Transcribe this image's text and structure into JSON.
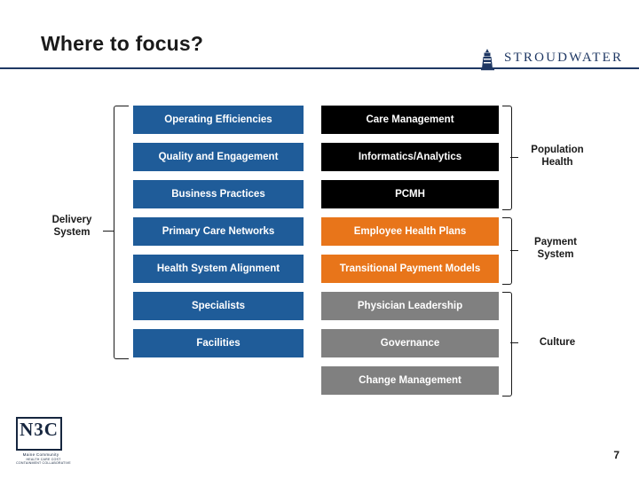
{
  "slide": {
    "title": "Where to focus?",
    "page_number": "7",
    "accent_rule_color": "#1f3864"
  },
  "brand_logo": {
    "name": "STROUDWATER",
    "icon": "lighthouse-icon",
    "color": "#1f3864"
  },
  "footer_logo": {
    "abbr": "N3C",
    "line1": "Maine Community",
    "line2": "HEALTH CARE COST CONTAINMENT COLLABORATIVE"
  },
  "side_labels": {
    "delivery_system": "Delivery\nSystem",
    "delivery_system_line1": "Delivery",
    "delivery_system_line2": "System",
    "population_health_line1": "Population",
    "population_health_line2": "Health",
    "payment_system_line1": "Payment",
    "payment_system_line2": "System",
    "culture": "Culture"
  },
  "columns": {
    "left": [
      {
        "label": "Operating Efficiencies",
        "color": "#1f5c99"
      },
      {
        "label": "Quality and Engagement",
        "color": "#1f5c99"
      },
      {
        "label": "Business Practices",
        "color": "#1f5c99"
      },
      {
        "label": "Primary Care Networks",
        "color": "#1f5c99"
      },
      {
        "label": "Health System Alignment",
        "color": "#1f5c99"
      },
      {
        "label": "Specialists",
        "color": "#1f5c99"
      },
      {
        "label": "Facilities",
        "color": "#1f5c99"
      }
    ],
    "right": [
      {
        "label": "Care Management",
        "color": "#000000"
      },
      {
        "label": "Informatics/Analytics",
        "color": "#000000"
      },
      {
        "label": "PCMH",
        "color": "#000000"
      },
      {
        "label": "Employee Health Plans",
        "color": "#e8751a"
      },
      {
        "label": "Transitional Payment Models",
        "color": "#e8751a"
      },
      {
        "label": "Physician Leadership",
        "color": "#808080"
      },
      {
        "label": "Governance",
        "color": "#808080"
      },
      {
        "label": "Change Management",
        "color": "#808080"
      }
    ]
  }
}
